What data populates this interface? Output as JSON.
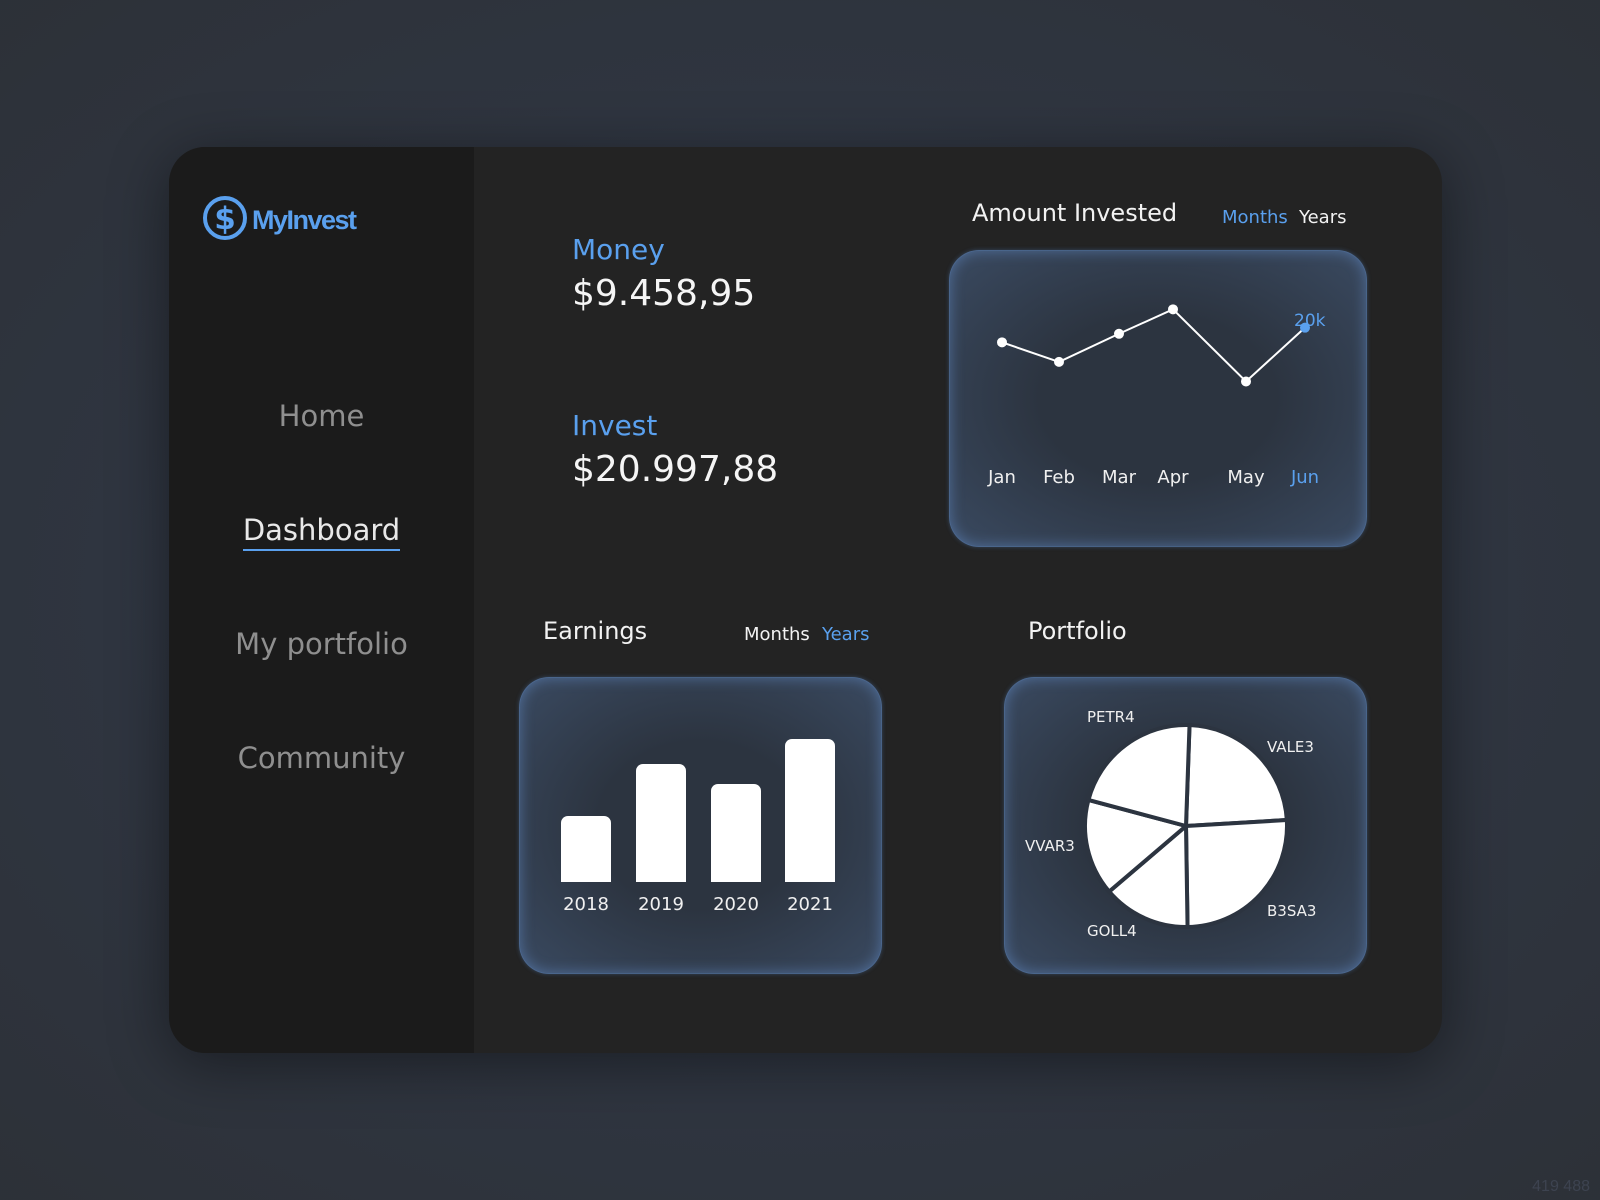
{
  "app": {
    "name": "MyInvest",
    "logo_icon": "dollar-circle-icon",
    "brand_color": "#5aa0ee"
  },
  "sidebar": {
    "items": [
      {
        "label": "Home",
        "active": false
      },
      {
        "label": "Dashboard",
        "active": true
      },
      {
        "label": "My portfolio",
        "active": false
      },
      {
        "label": "Community",
        "active": false
      }
    ]
  },
  "stats": {
    "money": {
      "label": "Money",
      "value": "$9.458,95"
    },
    "invest": {
      "label": "Invest",
      "value": "$20.997,88"
    }
  },
  "amount_invested": {
    "title": "Amount Invested",
    "toggle": {
      "months": "Months",
      "years": "Years",
      "selected": "Months"
    },
    "highlight_label": "20k"
  },
  "earnings": {
    "title": "Earnings",
    "toggle": {
      "months": "Months",
      "years": "Years",
      "selected": "Years"
    }
  },
  "portfolio": {
    "title": "Portfolio"
  },
  "watermark": "419 488",
  "chart_data": [
    {
      "type": "line",
      "title": "Amount Invested",
      "x": [
        "Jan",
        "Feb",
        "Mar",
        "Apr",
        "May",
        "Jun"
      ],
      "series": [
        {
          "values": [
            18.8,
            17.2,
            19.5,
            21.5,
            15.6,
            20.0
          ]
        }
      ],
      "highlight": {
        "category": "Jun",
        "label": "20k"
      },
      "ylim": [
        14,
        23
      ]
    },
    {
      "type": "bar",
      "title": "Earnings",
      "categories": [
        "2018",
        "2019",
        "2020",
        "2021"
      ],
      "values": [
        45,
        81,
        67,
        98
      ],
      "ylim": [
        0,
        100
      ]
    },
    {
      "type": "pie",
      "title": "Portfolio",
      "slices": [
        {
          "label": "VALE3",
          "value": 23.5
        },
        {
          "label": "B3SA3",
          "value": 25.7
        },
        {
          "label": "GOLL4",
          "value": 14.0
        },
        {
          "label": "VVAR3",
          "value": 15.4
        },
        {
          "label": "PETR4",
          "value": 21.4
        }
      ]
    }
  ]
}
